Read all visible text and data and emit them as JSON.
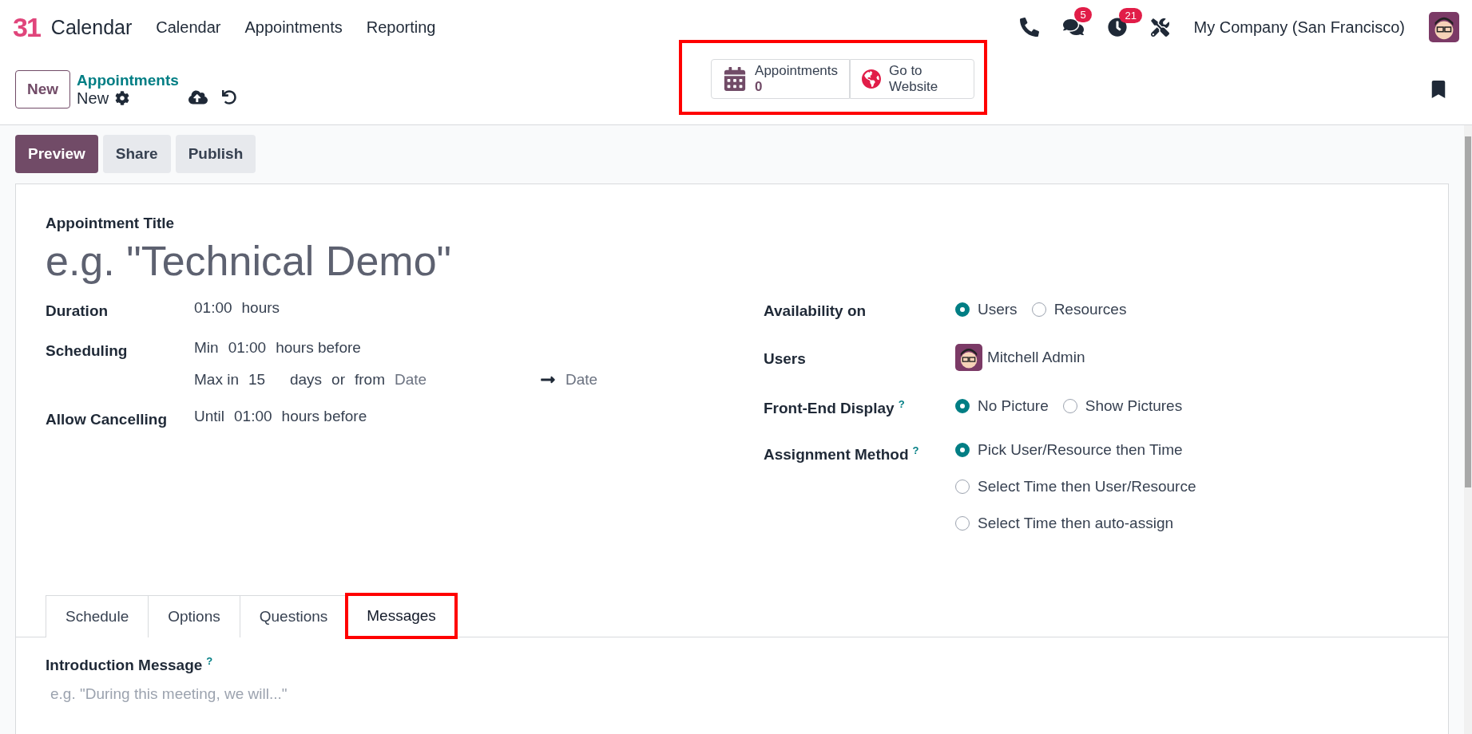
{
  "app": {
    "logo": "31",
    "name": "Calendar"
  },
  "menu": [
    {
      "label": "Calendar"
    },
    {
      "label": "Appointments"
    },
    {
      "label": "Reporting"
    }
  ],
  "systray": {
    "chat_count": "5",
    "activity_count": "21",
    "company": "My Company (San Francisco)"
  },
  "control_panel": {
    "new_button": "New",
    "breadcrumb": "Appointments",
    "record": "New"
  },
  "smart_buttons": {
    "highlighted": true,
    "items": [
      {
        "kind": "stat",
        "label": "Appointments",
        "value": "0"
      },
      {
        "kind": "link",
        "label": "Go to Website"
      }
    ]
  },
  "actions": [
    {
      "label": "Preview",
      "primary": true
    },
    {
      "label": "Share",
      "primary": false
    },
    {
      "label": "Publish",
      "primary": false
    }
  ],
  "form": {
    "title_label": "Appointment Title",
    "title_placeholder": "e.g. \"Technical Demo\"",
    "left_fields": [
      {
        "label": "Duration",
        "lines": [
          [
            {
              "kind": "value",
              "text": "01:00"
            },
            {
              "kind": "text",
              "text": "hours"
            }
          ]
        ]
      },
      {
        "label": "Scheduling",
        "lines": [
          [
            {
              "kind": "text",
              "text": "Min"
            },
            {
              "kind": "value",
              "text": "01:00"
            },
            {
              "kind": "text",
              "text": "hours before"
            }
          ],
          [
            {
              "kind": "text",
              "text": "Max in"
            },
            {
              "kind": "value",
              "text": "15"
            },
            {
              "kind": "text",
              "text": "days"
            },
            {
              "kind": "text",
              "text": "or"
            },
            {
              "kind": "text",
              "text": "from"
            },
            {
              "kind": "placeholder",
              "text": "Date"
            },
            {
              "kind": "arrow"
            },
            {
              "kind": "placeholder",
              "text": "Date"
            }
          ]
        ]
      },
      {
        "label": "Allow Cancelling",
        "lines": [
          [
            {
              "kind": "text",
              "text": "Until"
            },
            {
              "kind": "value",
              "text": "01:00"
            },
            {
              "kind": "text",
              "text": "hours before"
            }
          ]
        ]
      }
    ],
    "right_fields": [
      {
        "kind": "radio_row",
        "label": "Availability on",
        "options": [
          {
            "label": "Users",
            "selected": true
          },
          {
            "label": "Resources",
            "selected": false
          }
        ]
      },
      {
        "kind": "user",
        "label": "Users",
        "value": "Mitchell Admin"
      },
      {
        "kind": "radio_row",
        "label": "Front-End Display",
        "help": "?",
        "options": [
          {
            "label": "No Picture",
            "selected": true
          },
          {
            "label": "Show Pictures",
            "selected": false
          }
        ]
      },
      {
        "kind": "radio_column",
        "label": "Assignment Method",
        "help": "?",
        "options": [
          {
            "label": "Pick User/Resource then Time",
            "selected": true
          },
          {
            "label": "Select Time then User/Resource",
            "selected": false
          },
          {
            "label": "Select Time then auto-assign",
            "selected": false
          }
        ]
      }
    ]
  },
  "tabs": [
    {
      "label": "Schedule",
      "selected": false,
      "highlighted": false
    },
    {
      "label": "Options",
      "selected": false,
      "highlighted": false
    },
    {
      "label": "Questions",
      "selected": false,
      "highlighted": false
    },
    {
      "label": "Messages",
      "selected": true,
      "highlighted": true
    }
  ],
  "messages": {
    "label": "Introduction Message",
    "help": "?",
    "placeholder": "e.g. \"During this meeting, we will...\""
  }
}
